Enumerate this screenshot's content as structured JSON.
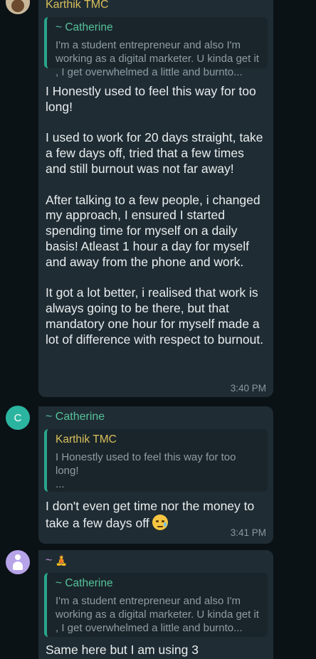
{
  "colors": {
    "background": "#0b1216",
    "bubble": "#1f2c33",
    "quote_bar": "#2aa58c",
    "karthik_name": "#d9bf5b",
    "catherine_name": "#55c29a",
    "timestamp": "#8c979e"
  },
  "messages": [
    {
      "sender": "Karthik TMC",
      "avatar_icon": "avatar-photo",
      "quote": {
        "name": "~ Catherine",
        "text": "I'm a student entrepreneur and also I'm working as a digital marketer. U kinda get it , I get overwhelmed a little and burnto..."
      },
      "body": "I Honestly used to feel this way for too long!\n\nI used to work for 20 days straight, take a few days off, tried that a few times and still burnout was not far away!\n\nAfter talking to a few people, i changed my approach, I ensured I started spending time for myself on a daily basis! Atleast 1 hour a day for myself and away from the phone and work.\n\nIt got a lot better, i realised that work is always going to be there, but that mandatory one hour for myself made a lot of difference with respect to burnout.",
      "time": "3:40 PM"
    },
    {
      "sender": "~ Catherine",
      "avatar_letter": "C",
      "quote": {
        "name": "Karthik TMC",
        "text": "I Honestly used to feel this way for too long!\n..."
      },
      "body": "I don't even get time nor the money to take a few days off",
      "emoji": "crying-face-emoji",
      "time": "3:41 PM"
    },
    {
      "sender": "~",
      "sender_emoji": "🧘",
      "avatar_icon": "person-icon",
      "quote": {
        "name": "~ Catherine",
        "text": "I'm a student entrepreneur and also I'm working as a digital marketer. U kinda get it , I get overwhelmed a little and burnto..."
      },
      "body": "Same here but I am using 3"
    }
  ]
}
